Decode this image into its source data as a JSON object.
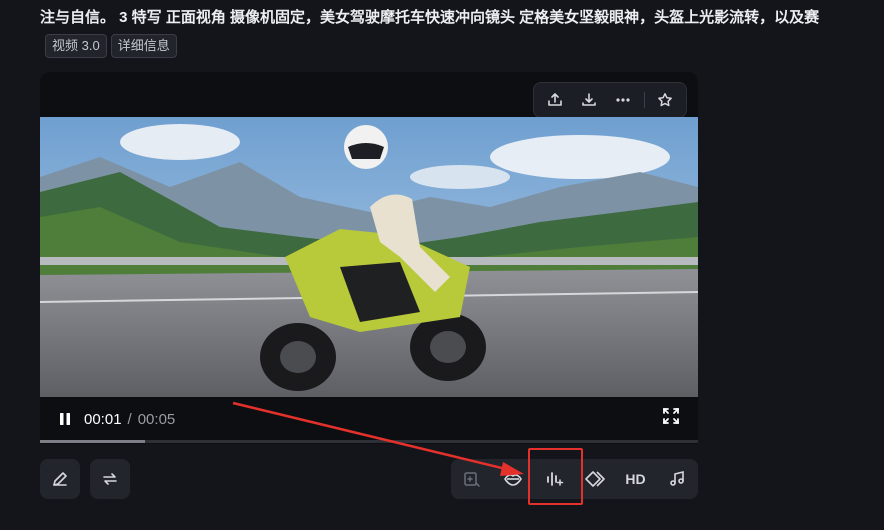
{
  "prompt_text": "注与自信。 3 特写 正面视角 摄像机固定，美女驾驶摩托车快速冲向镜头 定格美女坚毅眼神，头盔上光影流转，以及赛",
  "tags": [
    "视频 3.0",
    "详细信息"
  ],
  "toolbar": {
    "icons": [
      "share-icon",
      "download-icon",
      "more-icon",
      "star-icon"
    ]
  },
  "video": {
    "current_time": "00:01",
    "separator": "/",
    "total_time": "00:05",
    "progress": 0.16
  },
  "bottom_actions": {
    "left": [
      "edit-icon",
      "regenerate-icon"
    ],
    "right_hd_label": "HD",
    "right": [
      "frame-extend-icon",
      "lip-sync-icon",
      "audio-generate-icon",
      "interpolate-icon",
      "hd-upscale",
      "music-icon"
    ]
  },
  "annotation": {
    "highlight_color": "#e4312b"
  }
}
